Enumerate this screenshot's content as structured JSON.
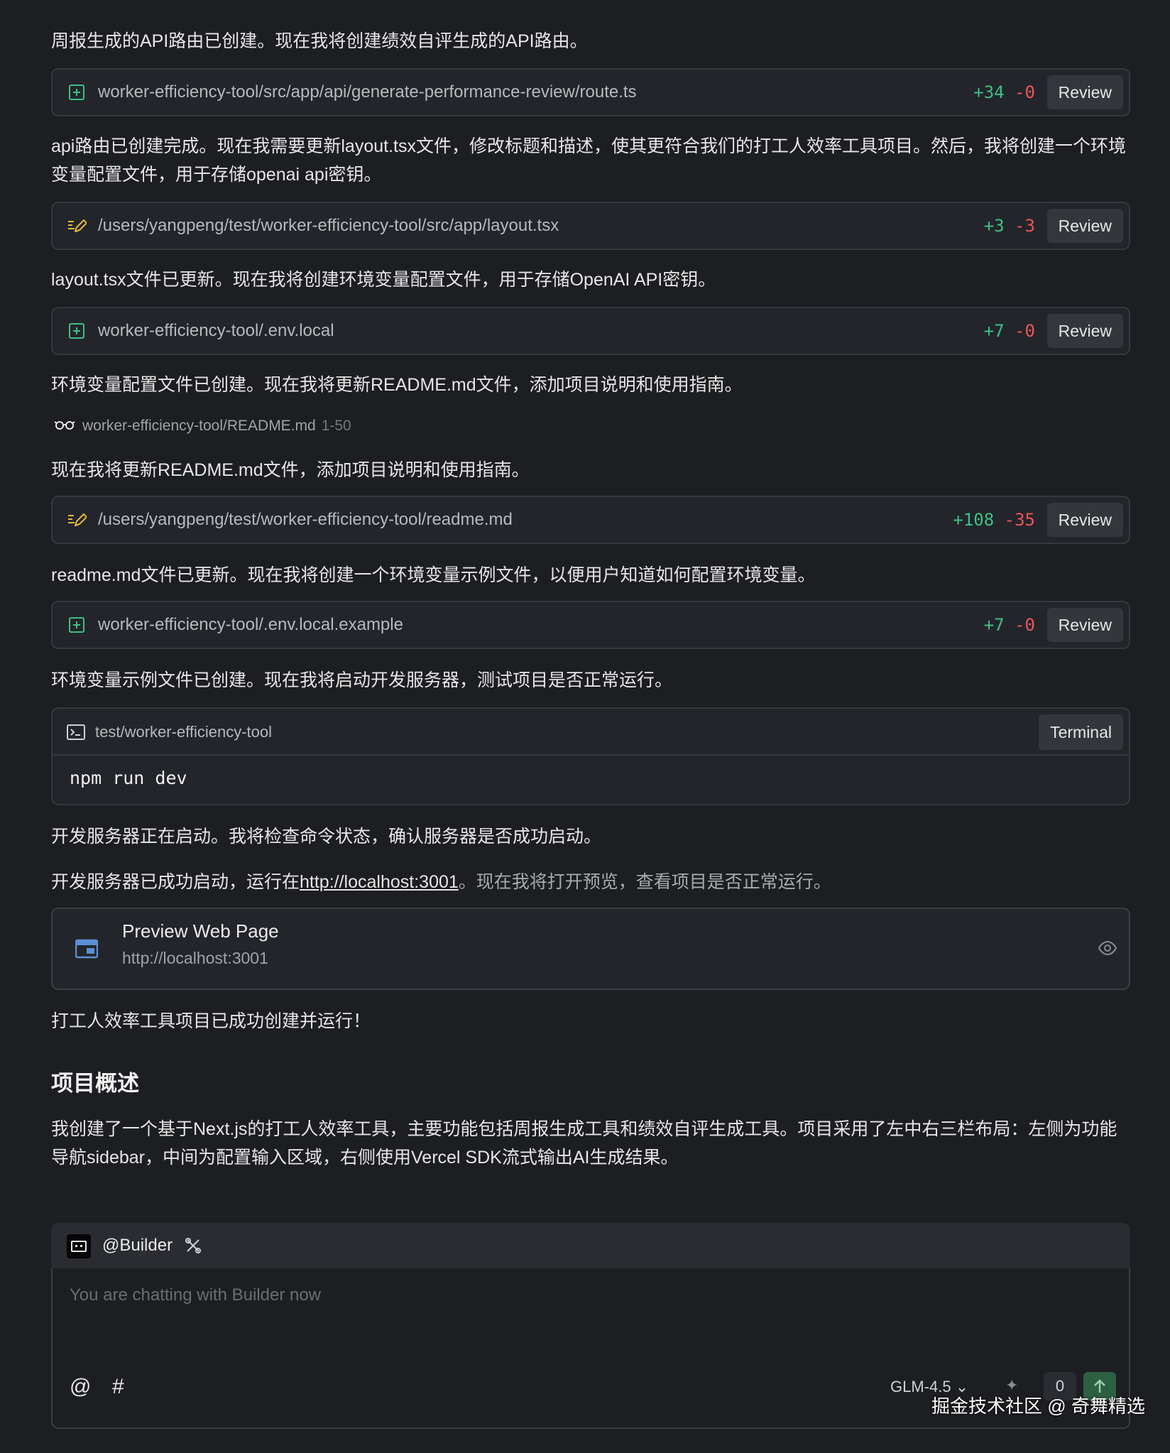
{
  "messages": {
    "m1": "周报生成的API路由已创建。现在我将创建绩效自评生成的API路由。",
    "m2": "api路由已创建完成。现在我需要更新layout.tsx文件，修改标题和描述，使其更符合我们的打工人效率工具项目。然后，我将创建一个环境变量配置文件，用于存储openai api密钥。",
    "m3": "layout.tsx文件已更新。现在我将创建环境变量配置文件，用于存储OpenAI API密钥。",
    "m4": "环境变量配置文件已创建。现在我将更新README.md文件，添加项目说明和使用指南。",
    "m5": "现在我将更新README.md文件，添加项目说明和使用指南。",
    "m6": "readme.md文件已更新。现在我将创建一个环境变量示例文件，以便用户知道如何配置环境变量。",
    "m7": "环境变量示例文件已创建。现在我将启动开发服务器，测试项目是否正常运行。",
    "m8": "开发服务器正在启动。我将检查命令状态，确认服务器是否成功启动。",
    "m9_prefix": "开发服务器已成功启动，运行在",
    "m9_link": "http://localhost:3001",
    "m9_suffix": "。现在我将打开预览，查看项目是否正常运行。",
    "m10": "打工人效率工具项目已成功创建并运行！",
    "heading": "项目概述",
    "m11": "我创建了一个基于Next.js的打工人效率工具，主要功能包括周报生成工具和绩效自评生成工具。项目采用了左中右三栏布局：左侧为功能导航sidebar，中间为配置输入区域，右侧使用Vercel SDK流式输出AI生成结果。"
  },
  "files": [
    {
      "icon": "file-add-icon",
      "path": "worker-efficiency-tool/src/app/api/generate-performance-review/route.ts",
      "added": "+34",
      "removed": "-0",
      "action": "Review"
    },
    {
      "icon": "file-edit-icon",
      "path": "/users/yangpeng/test/worker-efficiency-tool/src/app/layout.tsx",
      "added": "+3",
      "removed": "-3",
      "action": "Review"
    },
    {
      "icon": "file-add-icon",
      "path": "worker-efficiency-tool/.env.local",
      "added": "+7",
      "removed": "-0",
      "action": "Review"
    },
    {
      "icon": "file-edit-icon",
      "path": "/users/yangpeng/test/worker-efficiency-tool/readme.md",
      "added": "+108",
      "removed": "-35",
      "action": "Review"
    },
    {
      "icon": "file-add-icon",
      "path": "worker-efficiency-tool/.env.local.example",
      "added": "+7",
      "removed": "-0",
      "action": "Review"
    }
  ],
  "read": {
    "icon": "glasses-icon",
    "path": "worker-efficiency-tool/README.md",
    "range": "1-50"
  },
  "terminal": {
    "icon": "terminal-icon",
    "path": "test/worker-efficiency-tool",
    "button": "Terminal",
    "command": "npm run dev"
  },
  "preview": {
    "icon": "browser-window-icon",
    "title": "Preview Web Page",
    "url": "http://localhost:3001",
    "action_icon": "eye-icon"
  },
  "composer": {
    "agent": "@Builder",
    "agent_icon": "builder-avatar-icon",
    "tools_icon": "tools-icon",
    "placeholder": "You are chatting with Builder now",
    "mention_symbol": "@",
    "hash_symbol": "#",
    "model": "GLM-4.5",
    "count": "0"
  },
  "watermark": "掘金技术社区 @ 奇舞精选",
  "colors": {
    "background": "#1d1e21",
    "added": "#3fbf84",
    "removed": "#e8555a",
    "accent": "#5b8fd6"
  }
}
